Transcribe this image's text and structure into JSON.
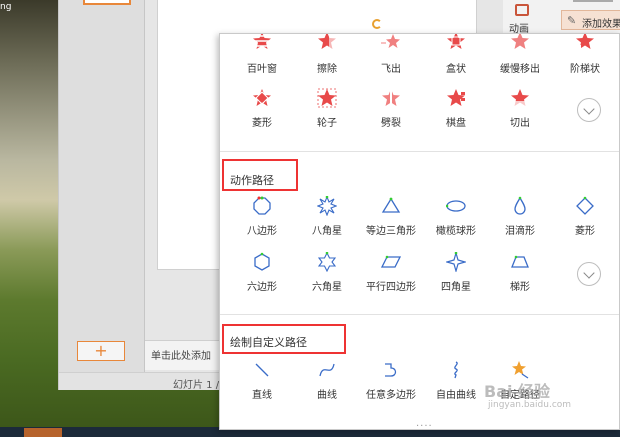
{
  "desktop": {
    "left_text": "ng"
  },
  "wps": {
    "notes_placeholder": "单击此处添加",
    "status": "幻灯片 1 /"
  },
  "right_pane": {
    "anim_label": "动画",
    "add_effect": "添加效果"
  },
  "dropdown": {
    "entrance_row1": [
      "百叶窗",
      "擦除",
      "飞出",
      "盒状",
      "缓慢移出",
      "阶梯状"
    ],
    "entrance_row2": [
      "菱形",
      "轮子",
      "劈裂",
      "棋盘",
      "切出"
    ],
    "motion_paths_title": "动作路径",
    "paths_row1": [
      "八边形",
      "八角星",
      "等边三角形",
      "橄榄球形",
      "泪滴形",
      "菱形"
    ],
    "paths_row2": [
      "六边形",
      "六角星",
      "平行四边形",
      "四角星",
      "梯形"
    ],
    "custom_paths_title": "绘制自定义路径",
    "custom_row": [
      "直线",
      "曲线",
      "任意多边形",
      "自由曲线",
      "自定路径"
    ],
    "more_dots": "....",
    "accent_star": "#e84a4a",
    "path_stroke": "#3a6cc8"
  },
  "watermark": {
    "main": "Bai 经验",
    "sub": "jingyan.baidu.com"
  }
}
